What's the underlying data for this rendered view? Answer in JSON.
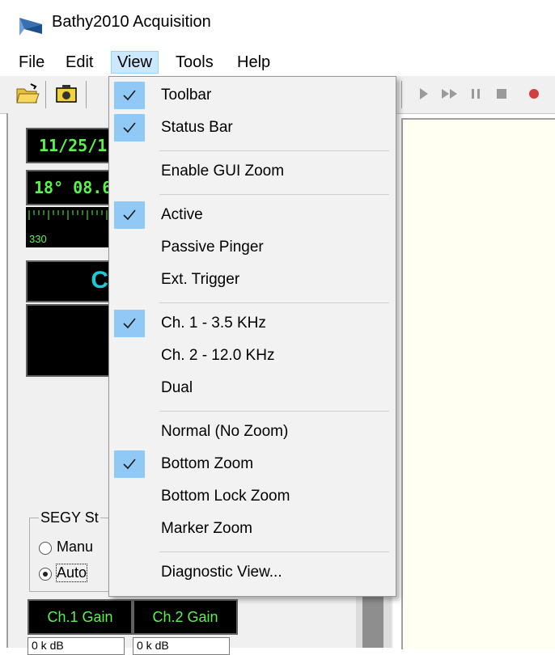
{
  "window": {
    "title": "Bathy2010 Acquisition"
  },
  "menubar": [
    {
      "label": "File",
      "open": false
    },
    {
      "label": "Edit",
      "open": false
    },
    {
      "label": "View",
      "open": true
    },
    {
      "label": "Tools",
      "open": false
    },
    {
      "label": "Help",
      "open": false
    }
  ],
  "left_panel": {
    "date_display": "11/25/1",
    "position_display": "18° 08.6",
    "compass_label": "330",
    "cyan_display": "C",
    "segy_group_title": "SEGY St",
    "radio_manual": "Manu",
    "radio_auto": "Auto",
    "radio_selected": "auto",
    "ch1_gain": "Ch.1 Gain",
    "ch2_gain": "Ch.2 Gain",
    "ch1_combo_value": "0 k dB",
    "ch2_combo_value": "0 k dB"
  },
  "view_menu": {
    "items": [
      {
        "label": "Toolbar",
        "checked": true
      },
      {
        "label": "Status Bar",
        "checked": true
      },
      {
        "label": "Enable GUI Zoom",
        "checked": false
      },
      {
        "label": "Active",
        "checked": true
      },
      {
        "label": "Passive Pinger",
        "checked": false
      },
      {
        "label": "Ext. Trigger",
        "checked": false
      },
      {
        "label": "Ch. 1 - 3.5 KHz",
        "checked": true
      },
      {
        "label": "Ch. 2 - 12.0 KHz",
        "checked": false
      },
      {
        "label": "Dual",
        "checked": false
      },
      {
        "label": "Normal (No Zoom)",
        "checked": false
      },
      {
        "label": "Bottom Zoom",
        "checked": true
      },
      {
        "label": "Bottom Lock Zoom",
        "checked": false
      },
      {
        "label": "Marker Zoom",
        "checked": false
      },
      {
        "label": "Diagnostic View...",
        "checked": false
      }
    ]
  },
  "colors": {
    "lcd_green": "#5cf24d",
    "lcd_cyan": "#1ec9d8",
    "check_highlight": "#90c8f6",
    "menu_open_bg": "#cce8ff"
  }
}
